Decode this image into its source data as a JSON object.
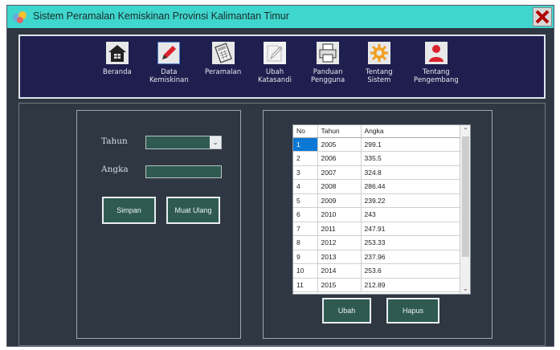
{
  "window": {
    "title": "Sistem Peramalan Kemiskinan Provinsi Kalimantan Timur"
  },
  "menu": [
    {
      "label": "Beranda",
      "icon": "home-icon"
    },
    {
      "label": "Data\nKemiskinan",
      "icon": "pencil-icon"
    },
    {
      "label": "Peramalan",
      "icon": "calculator-icon"
    },
    {
      "label": "Ubah\nKatasandi",
      "icon": "edit-password-icon"
    },
    {
      "label": "Panduan\nPengguna",
      "icon": "printer-icon"
    },
    {
      "label": "Tentang\nSistem",
      "icon": "gear-icon"
    },
    {
      "label": "Tentang\nPengembang",
      "icon": "user-icon"
    }
  ],
  "form": {
    "tahun_label": "Tahun",
    "angka_label": "Angka",
    "tahun_value": "",
    "angka_value": "",
    "simpan_label": "Simpan",
    "muat_ulang_label": "Muat Ulang"
  },
  "grid": {
    "headers": [
      "No",
      "Tahun",
      "Angka"
    ],
    "rows": [
      [
        "1",
        "2005",
        "299.1"
      ],
      [
        "2",
        "2006",
        "335.5"
      ],
      [
        "3",
        "2007",
        "324.8"
      ],
      [
        "4",
        "2008",
        "286.44"
      ],
      [
        "5",
        "2009",
        "239.22"
      ],
      [
        "6",
        "2010",
        "243"
      ],
      [
        "7",
        "2011",
        "247.91"
      ],
      [
        "8",
        "2012",
        "253.33"
      ],
      [
        "9",
        "2013",
        "237.96"
      ],
      [
        "10",
        "2014",
        "253.6"
      ],
      [
        "11",
        "2015",
        "212.89"
      ]
    ],
    "selected_row": 1
  },
  "actions": {
    "ubah_label": "Ubah",
    "hapus_label": "Hapus"
  },
  "colors": {
    "titlebar": "#3fd6cd",
    "menubar": "#1f1f4f",
    "background": "#2f3842",
    "input": "#2e5a52",
    "selection": "#0a78d4"
  }
}
